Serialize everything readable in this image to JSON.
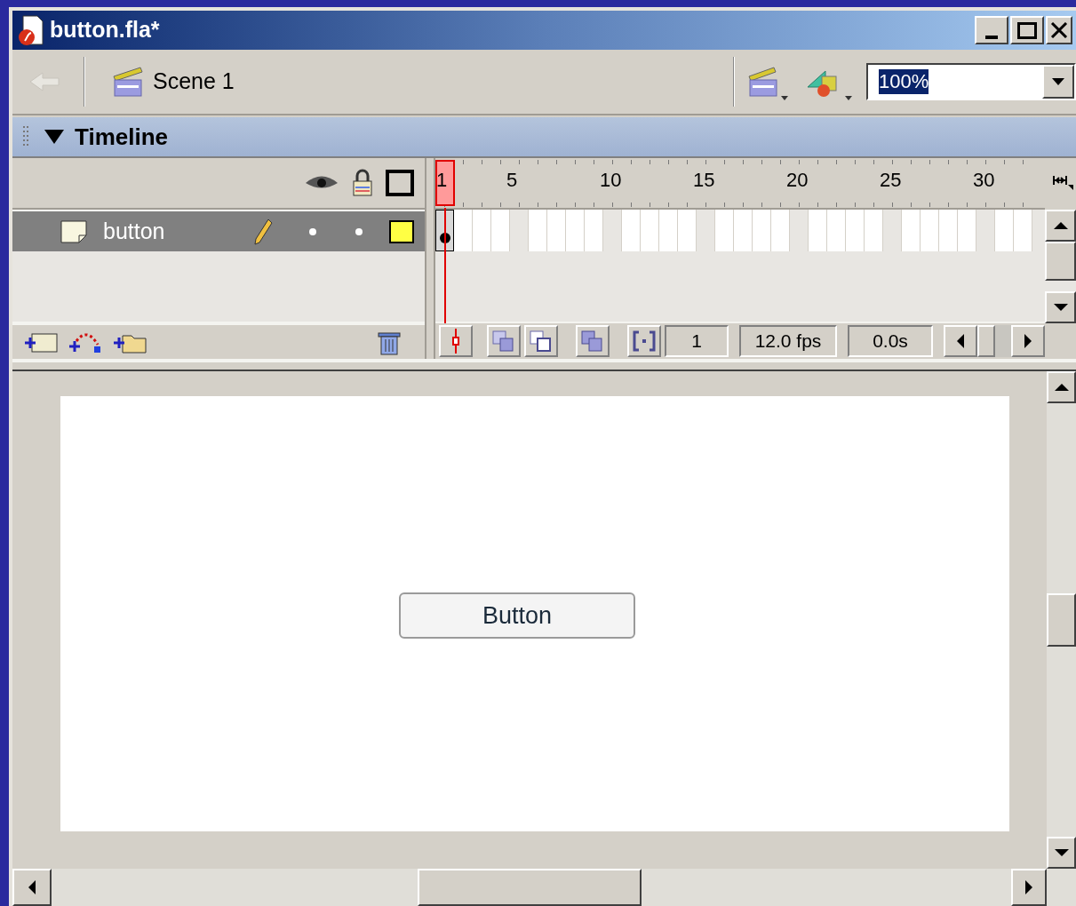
{
  "window": {
    "title": "button.fla*"
  },
  "toolbar": {
    "scene": "Scene 1",
    "zoom": "100%"
  },
  "timeline": {
    "title": "Timeline",
    "expanded": true,
    "ruler": [
      "1",
      "5",
      "10",
      "15",
      "20",
      "25",
      "30"
    ],
    "layers": [
      {
        "name": "button",
        "selected": true,
        "color": "#ffff44"
      }
    ],
    "current_frame": "1",
    "fps": "12.0 fps",
    "elapsed": "0.0s"
  },
  "stage": {
    "button_label": "Button"
  }
}
